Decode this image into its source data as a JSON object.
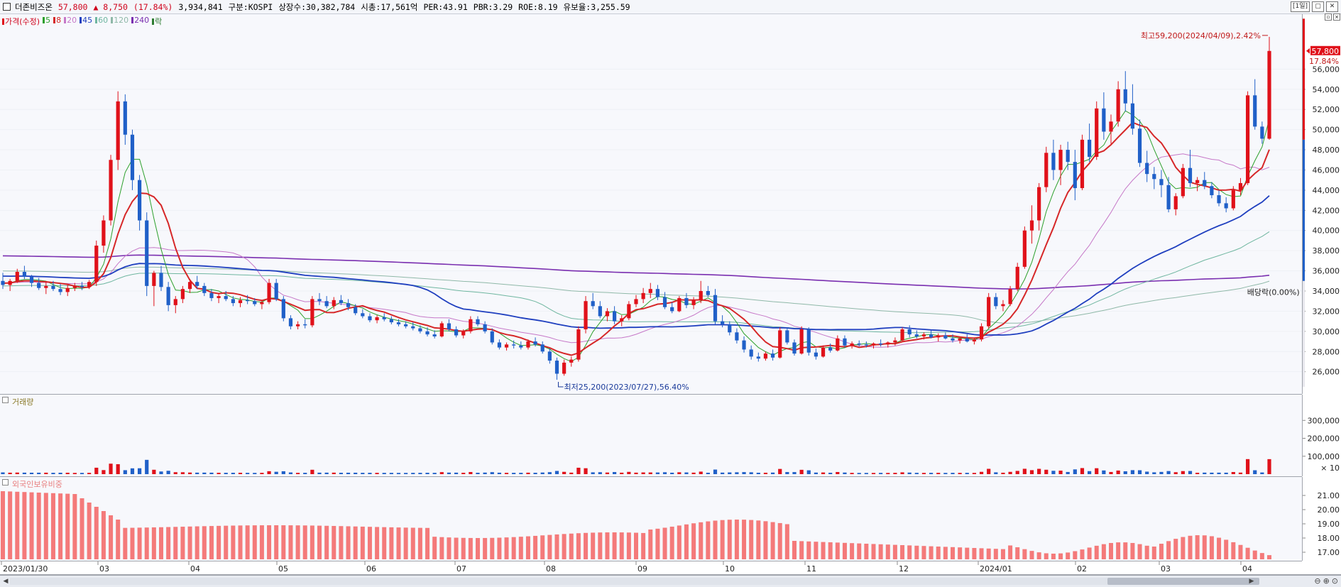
{
  "header": {
    "stock_name": "더존비즈온",
    "price": "57,800",
    "change": "▲ 8,750",
    "change_pct": "(17.84%)",
    "volume": "3,934,841",
    "market": "구분:KOSPI",
    "shares": "상장수:30,382,784",
    "mcap": "시총:17,561억",
    "per": "PER:43.91",
    "pbr": "PBR:3.29",
    "roe": "ROE:8.19",
    "float": "유보율:3,255.59",
    "period": "[1일]"
  },
  "legend": {
    "price_label": "가격(수정)",
    "ma": [
      {
        "label": "5",
        "color": "#2ca02c"
      },
      {
        "label": "8",
        "color": "#d62728"
      },
      {
        "label": "20",
        "color": "#c678c8"
      },
      {
        "label": "45",
        "color": "#1f3fbf"
      },
      {
        "label": "60",
        "color": "#6fb6a0"
      },
      {
        "label": "120",
        "color": "#8fb8a8"
      },
      {
        "label": "240",
        "color": "#7a2fb0"
      },
      {
        "label": "락",
        "color": "#2e7d32"
      }
    ]
  },
  "annotations": {
    "high": "최고59,200(2024/04/09),2.42%",
    "low": "최저25,200(2023/07/27),56.40%",
    "dividend": "배당락(0.00%)",
    "current_price_tag": "57,800",
    "current_pct_tag": "17.84%"
  },
  "volume_panel": {
    "label": "거래량",
    "ticks": [
      "300,000",
      "200,000",
      "100,000"
    ],
    "unit": "× 10"
  },
  "foreign_panel": {
    "label": "외국인보유비중",
    "ticks": [
      "21.00",
      "20.00",
      "19.00",
      "18.00",
      "17.00"
    ]
  },
  "x_axis": [
    "2023/01/30",
    "03",
    "04",
    "05",
    "06",
    "07",
    "08",
    "09",
    "10",
    "11",
    "12",
    "2024/01",
    "02",
    "03",
    "04"
  ],
  "colors": {
    "up": "#e0111a",
    "down": "#2060c8",
    "foreign": "#f47a7a",
    "background": "#f7f8fc"
  },
  "chart_data": {
    "type": "candlestick",
    "price_axis": {
      "ticks": [
        26000,
        28000,
        30000,
        32000,
        34000,
        36000,
        38000,
        40000,
        42000,
        44000,
        46000,
        48000,
        50000,
        52000,
        54000,
        56000
      ],
      "range": [
        24500,
        60600
      ]
    },
    "candles": [
      [
        35000,
        35800,
        34200,
        34600
      ],
      [
        34600,
        35200,
        34000,
        35000
      ],
      [
        35000,
        36200,
        34800,
        35900
      ],
      [
        35900,
        36500,
        35200,
        35400
      ],
      [
        35400,
        35600,
        34400,
        34800
      ],
      [
        34800,
        35300,
        34100,
        34300
      ],
      [
        34300,
        34900,
        33700,
        34500
      ],
      [
        34500,
        35000,
        34000,
        34200
      ],
      [
        34200,
        34700,
        33600,
        33900
      ],
      [
        33900,
        34600,
        33500,
        34300
      ],
      [
        34300,
        34800,
        34000,
        34500
      ],
      [
        34500,
        34900,
        34100,
        34400
      ],
      [
        34400,
        35100,
        34200,
        34900
      ],
      [
        34900,
        39000,
        34500,
        38500
      ],
      [
        38500,
        41500,
        37800,
        41000
      ],
      [
        41000,
        47500,
        40500,
        47000
      ],
      [
        47000,
        53800,
        46000,
        52800
      ],
      [
        52800,
        53500,
        48500,
        49500
      ],
      [
        49500,
        50000,
        44000,
        45000
      ],
      [
        45000,
        45500,
        40000,
        41000
      ],
      [
        41000,
        41800,
        33500,
        34500
      ],
      [
        34500,
        36000,
        32500,
        35800
      ],
      [
        35800,
        36500,
        34000,
        34400
      ],
      [
        34400,
        34900,
        32000,
        32600
      ],
      [
        32600,
        33500,
        31800,
        33200
      ],
      [
        33200,
        34500,
        32800,
        34200
      ],
      [
        34200,
        35200,
        33800,
        34900
      ],
      [
        34900,
        35500,
        34200,
        34500
      ],
      [
        34500,
        34800,
        33500,
        33800
      ],
      [
        33800,
        34200,
        33000,
        33300
      ],
      [
        33300,
        33800,
        32800,
        33500
      ],
      [
        33500,
        34000,
        33000,
        33200
      ],
      [
        33200,
        33500,
        32500,
        32800
      ],
      [
        32800,
        33400,
        32400,
        33100
      ],
      [
        33100,
        33600,
        32700,
        33000
      ],
      [
        33000,
        33300,
        32500,
        32700
      ],
      [
        32700,
        33100,
        32200,
        32900
      ],
      [
        32900,
        35200,
        32700,
        34800
      ],
      [
        34800,
        35200,
        33000,
        33200
      ],
      [
        33200,
        33500,
        31000,
        31300
      ],
      [
        31300,
        31600,
        30200,
        30500
      ],
      [
        30500,
        31000,
        30200,
        30700
      ],
      [
        30700,
        31200,
        30300,
        30600
      ],
      [
        30600,
        33500,
        30400,
        33200
      ],
      [
        33200,
        33800,
        32600,
        33000
      ],
      [
        33000,
        33500,
        32300,
        32500
      ],
      [
        32500,
        33400,
        32200,
        33100
      ],
      [
        33100,
        33600,
        32600,
        32800
      ],
      [
        32800,
        33200,
        32100,
        32400
      ],
      [
        32400,
        32700,
        31600,
        31800
      ],
      [
        31800,
        32200,
        31300,
        31500
      ],
      [
        31500,
        31800,
        30900,
        31100
      ],
      [
        31100,
        31600,
        30800,
        31400
      ],
      [
        31400,
        31800,
        31000,
        31200
      ],
      [
        31200,
        31500,
        30700,
        30900
      ],
      [
        30900,
        31200,
        30500,
        30700
      ],
      [
        30700,
        31000,
        30300,
        30500
      ],
      [
        30500,
        30900,
        30100,
        30300
      ],
      [
        30300,
        30600,
        29800,
        30000
      ],
      [
        30000,
        30400,
        29500,
        29700
      ],
      [
        29700,
        30100,
        29300,
        29500
      ],
      [
        29500,
        31000,
        29400,
        30800
      ],
      [
        30800,
        31200,
        30000,
        30200
      ],
      [
        30200,
        30500,
        29400,
        29600
      ],
      [
        29600,
        30200,
        29300,
        30000
      ],
      [
        30000,
        31500,
        29800,
        31200
      ],
      [
        31200,
        31500,
        30500,
        30700
      ],
      [
        30700,
        31000,
        29800,
        30000
      ],
      [
        30000,
        30300,
        28700,
        28900
      ],
      [
        28900,
        29200,
        28200,
        28400
      ],
      [
        28400,
        28900,
        28100,
        28700
      ],
      [
        28700,
        29100,
        28300,
        28600
      ],
      [
        28600,
        29000,
        28200,
        28400
      ],
      [
        28400,
        29200,
        28200,
        29000
      ],
      [
        29000,
        29400,
        28500,
        28700
      ],
      [
        28700,
        29000,
        27800,
        28000
      ],
      [
        28000,
        28300,
        26800,
        27100
      ],
      [
        27100,
        27400,
        25200,
        25800
      ],
      [
        25800,
        27200,
        25600,
        26900
      ],
      [
        26900,
        27500,
        26500,
        27200
      ],
      [
        27200,
        30500,
        27000,
        30200
      ],
      [
        30200,
        33500,
        29800,
        33000
      ],
      [
        33000,
        33800,
        32200,
        32500
      ],
      [
        32500,
        33000,
        31300,
        31500
      ],
      [
        31500,
        32300,
        31000,
        32000
      ],
      [
        32000,
        32500,
        30700,
        31000
      ],
      [
        31000,
        31600,
        30500,
        31300
      ],
      [
        31300,
        33000,
        31100,
        32700
      ],
      [
        32700,
        33600,
        32400,
        33200
      ],
      [
        33200,
        34300,
        32800,
        33800
      ],
      [
        33800,
        34800,
        33300,
        34200
      ],
      [
        34200,
        34600,
        33100,
        33400
      ],
      [
        33400,
        33900,
        32200,
        32400
      ],
      [
        32400,
        32900,
        31800,
        32000
      ],
      [
        32000,
        33500,
        31900,
        33300
      ],
      [
        33300,
        33800,
        32300,
        32600
      ],
      [
        32600,
        33400,
        32200,
        33100
      ],
      [
        33100,
        35000,
        32800,
        34000
      ],
      [
        34000,
        34500,
        33400,
        33600
      ],
      [
        33600,
        34200,
        30700,
        31000
      ],
      [
        31000,
        31600,
        30400,
        30700
      ],
      [
        30700,
        31000,
        29600,
        29900
      ],
      [
        29900,
        30300,
        28800,
        29100
      ],
      [
        29100,
        29500,
        27900,
        28200
      ],
      [
        28200,
        28600,
        27200,
        27500
      ],
      [
        27500,
        27900,
        27000,
        27300
      ],
      [
        27300,
        28000,
        27100,
        27800
      ],
      [
        27800,
        28200,
        27100,
        27400
      ],
      [
        27400,
        30400,
        27300,
        30100
      ],
      [
        30100,
        30400,
        28700,
        28900
      ],
      [
        28900,
        29200,
        27600,
        27800
      ],
      [
        27800,
        30500,
        27700,
        30200
      ],
      [
        30200,
        30400,
        27600,
        27900
      ],
      [
        27900,
        28300,
        27200,
        27500
      ],
      [
        27500,
        28600,
        27400,
        28400
      ],
      [
        28400,
        28800,
        27900,
        28100
      ],
      [
        28100,
        29600,
        28000,
        29300
      ],
      [
        29300,
        29600,
        28400,
        28600
      ],
      [
        28600,
        29000,
        28300,
        28800
      ],
      [
        28800,
        29100,
        28500,
        28700
      ],
      [
        28700,
        29000,
        28400,
        28600
      ],
      [
        28600,
        28900,
        28300,
        28800
      ],
      [
        28800,
        29200,
        28500,
        28700
      ],
      [
        28700,
        29000,
        28400,
        28900
      ],
      [
        28900,
        29400,
        28600,
        29100
      ],
      [
        29100,
        30400,
        29000,
        30200
      ],
      [
        30200,
        30600,
        29400,
        29700
      ],
      [
        29700,
        30100,
        29300,
        29500
      ],
      [
        29500,
        29900,
        29200,
        29700
      ],
      [
        29700,
        30100,
        29300,
        29400
      ],
      [
        29400,
        29800,
        29000,
        29600
      ],
      [
        29600,
        29900,
        29200,
        29300
      ],
      [
        29300,
        29700,
        28900,
        29100
      ],
      [
        29100,
        29500,
        28800,
        29300
      ],
      [
        29300,
        29700,
        28900,
        29000
      ],
      [
        29000,
        29400,
        28700,
        29200
      ],
      [
        29200,
        30800,
        29000,
        30500
      ],
      [
        30500,
        33800,
        30300,
        33400
      ],
      [
        33400,
        33800,
        32200,
        32500
      ],
      [
        32500,
        33100,
        32000,
        32700
      ],
      [
        32700,
        34500,
        32500,
        34200
      ],
      [
        34200,
        36800,
        34000,
        36400
      ],
      [
        36400,
        40400,
        36200,
        40000
      ],
      [
        40000,
        42500,
        38700,
        41000
      ],
      [
        41000,
        44700,
        40000,
        44300
      ],
      [
        44300,
        48300,
        43800,
        47700
      ],
      [
        47700,
        49000,
        45000,
        46000
      ],
      [
        46000,
        48500,
        44500,
        48000
      ],
      [
        48000,
        48800,
        46000,
        46800
      ],
      [
        46800,
        48000,
        43000,
        44200
      ],
      [
        44200,
        49500,
        44000,
        49000
      ],
      [
        49000,
        50600,
        46800,
        47300
      ],
      [
        47300,
        52800,
        47000,
        52100
      ],
      [
        52100,
        53700,
        49000,
        49800
      ],
      [
        49800,
        51500,
        48600,
        50800
      ],
      [
        50800,
        54800,
        50300,
        54000
      ],
      [
        54000,
        55800,
        51800,
        52600
      ],
      [
        52600,
        54500,
        49500,
        50100
      ],
      [
        50100,
        51000,
        46300,
        46700
      ],
      [
        46700,
        47900,
        44800,
        45600
      ],
      [
        45600,
        46300,
        44100,
        45100
      ],
      [
        45100,
        46000,
        43300,
        44500
      ],
      [
        44500,
        45300,
        41800,
        42100
      ],
      [
        42100,
        43700,
        41500,
        43400
      ],
      [
        43400,
        46600,
        43200,
        46200
      ],
      [
        46200,
        48000,
        44300,
        44700
      ],
      [
        44700,
        45300,
        43900,
        45000
      ],
      [
        45000,
        45800,
        44100,
        44400
      ],
      [
        44400,
        44800,
        43200,
        43500
      ],
      [
        43500,
        44000,
        42400,
        42700
      ],
      [
        42700,
        43300,
        41800,
        42200
      ],
      [
        42200,
        44400,
        42000,
        44000
      ],
      [
        44000,
        45200,
        43500,
        44700
      ],
      [
        44700,
        53800,
        44500,
        53400
      ],
      [
        53400,
        55000,
        50000,
        50300
      ],
      [
        50300,
        50800,
        48600,
        49100
      ],
      [
        49100,
        59200,
        49000,
        57800
      ]
    ],
    "ma_end": {
      "ma5": 48800,
      "ma20": 45500,
      "ma45": 46700,
      "ma120": 37500,
      "ma240": 34000
    }
  }
}
